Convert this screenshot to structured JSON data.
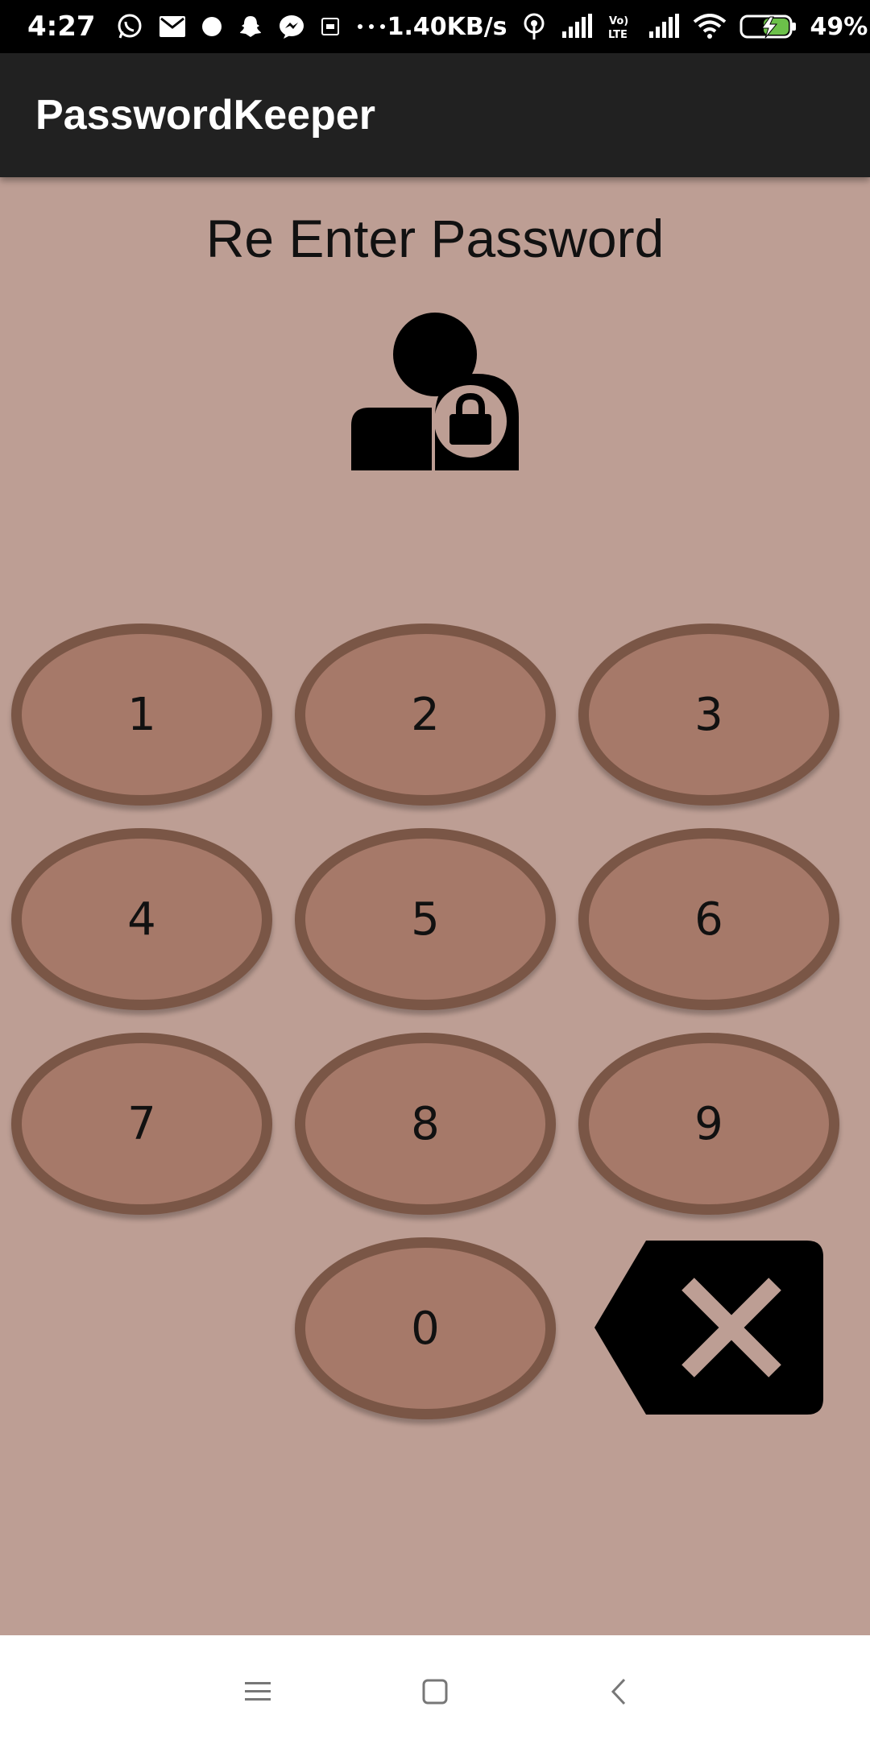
{
  "status_bar": {
    "time": "4:27",
    "network_speed": "1.40KB/s",
    "battery_percent": "49%",
    "icons": [
      "whatsapp-icon",
      "gmail-icon",
      "dot-icon",
      "snapchat-icon",
      "messenger-icon",
      "screenshot-icon",
      "more-dots-icon",
      "hotspot-icon",
      "signal-icon",
      "volte-icon",
      "signal-icon",
      "wifi-icon",
      "battery-charging-icon"
    ]
  },
  "app_bar": {
    "title": "PasswordKeeper"
  },
  "main": {
    "heading": "Re Enter Password",
    "icon": "user-lock-icon"
  },
  "keypad": {
    "keys": [
      "1",
      "2",
      "3",
      "4",
      "5",
      "6",
      "7",
      "8",
      "9",
      "0"
    ],
    "backspace_icon": "backspace-icon"
  },
  "nav_bar": {
    "icons": [
      "menu-icon",
      "home-icon",
      "back-icon"
    ]
  },
  "colors": {
    "background": "#BD9E94",
    "app_bar": "#212121",
    "key_fill": "#A67969",
    "key_border": "#7A5646"
  }
}
